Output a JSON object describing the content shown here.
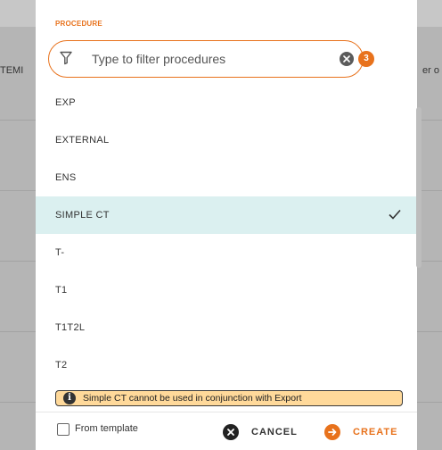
{
  "background": {
    "left_column_label": "TEMI",
    "right_column_label": "er o"
  },
  "dialog": {
    "procedure_label": "PROCEDURE",
    "filter": {
      "placeholder": "Type to filter procedures",
      "value": "",
      "icon": "funnel-icon",
      "clear_icon": "close-icon"
    },
    "count_badge": "3",
    "procedures": [
      {
        "label": "EXP",
        "selected": false
      },
      {
        "label": "EXTERNAL",
        "selected": false
      },
      {
        "label": "ENS",
        "selected": false
      },
      {
        "label": "SIMPLE CT",
        "selected": true
      },
      {
        "label": "T-",
        "selected": false
      },
      {
        "label": "T1",
        "selected": false
      },
      {
        "label": "T1T2L",
        "selected": false
      },
      {
        "label": "T2",
        "selected": false
      }
    ],
    "warning_text": "Simple CT cannot be used in conjunction with Export",
    "from_template_label": "From template",
    "from_template_checked": false,
    "cancel_label": "CANCEL",
    "create_label": "CREATE",
    "colors": {
      "accent": "#e8721c",
      "selected_row": "#dbf0f0",
      "warning_bg": "#ffd99a"
    }
  }
}
